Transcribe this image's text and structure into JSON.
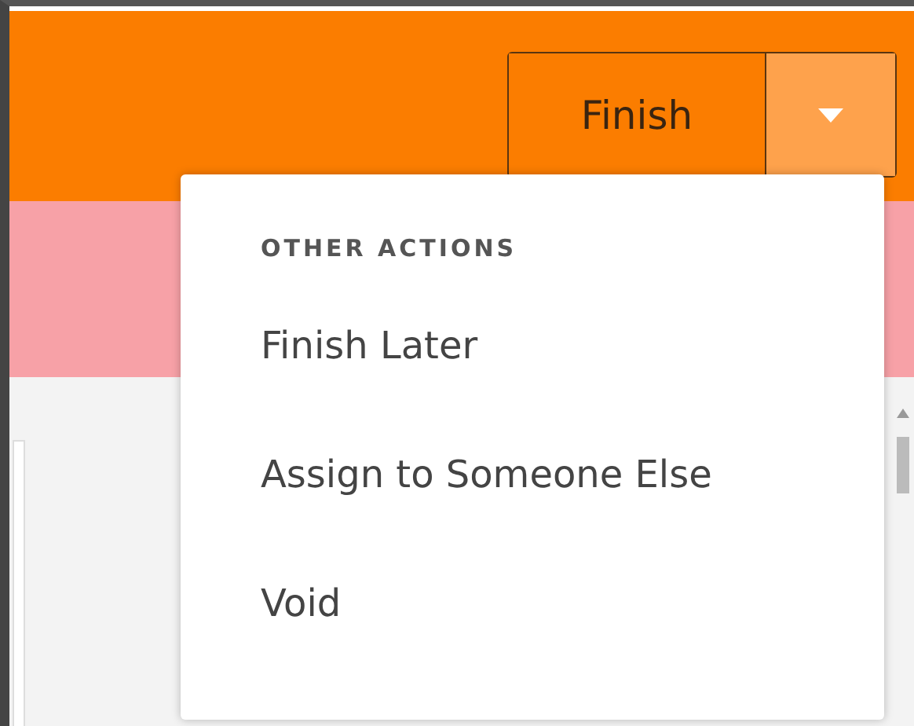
{
  "toolbar": {
    "primary_button": "Finish"
  },
  "menu": {
    "expanded": true,
    "heading": "OTHER ACTIONS",
    "items": [
      {
        "label": "Finish Later"
      },
      {
        "label": "Assign to Someone Else"
      },
      {
        "label": "Void"
      }
    ]
  }
}
